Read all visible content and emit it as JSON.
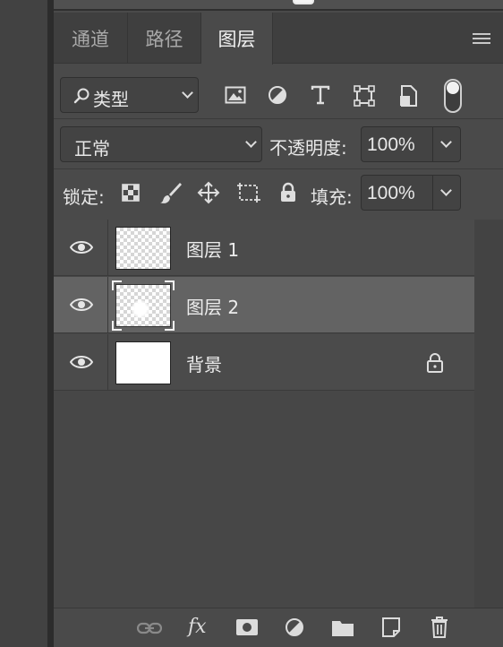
{
  "tabs": [
    {
      "label": "通道"
    },
    {
      "label": "路径"
    },
    {
      "label": "图层"
    }
  ],
  "filter": {
    "label": "类型"
  },
  "blend": {
    "mode": "正常",
    "opacity_label": "不透明度:",
    "opacity_value": "100%"
  },
  "lock": {
    "label": "锁定:",
    "fill_label": "填充:",
    "fill_value": "100%"
  },
  "layers": [
    {
      "name": "图层 1",
      "visible": true
    },
    {
      "name": "图层 2",
      "visible": true,
      "selected": true
    },
    {
      "name": "背景",
      "visible": true,
      "locked": true
    }
  ],
  "bottom_actions": [
    "link-layers-icon",
    "fx-icon",
    "add-mask-icon",
    "adjustment-layer-icon",
    "new-group-icon",
    "new-layer-icon",
    "delete-layer-icon"
  ],
  "colors": {
    "panel_bg": "#4a4a4a",
    "selected_row": "#636363",
    "text": "#e6e6e6"
  }
}
